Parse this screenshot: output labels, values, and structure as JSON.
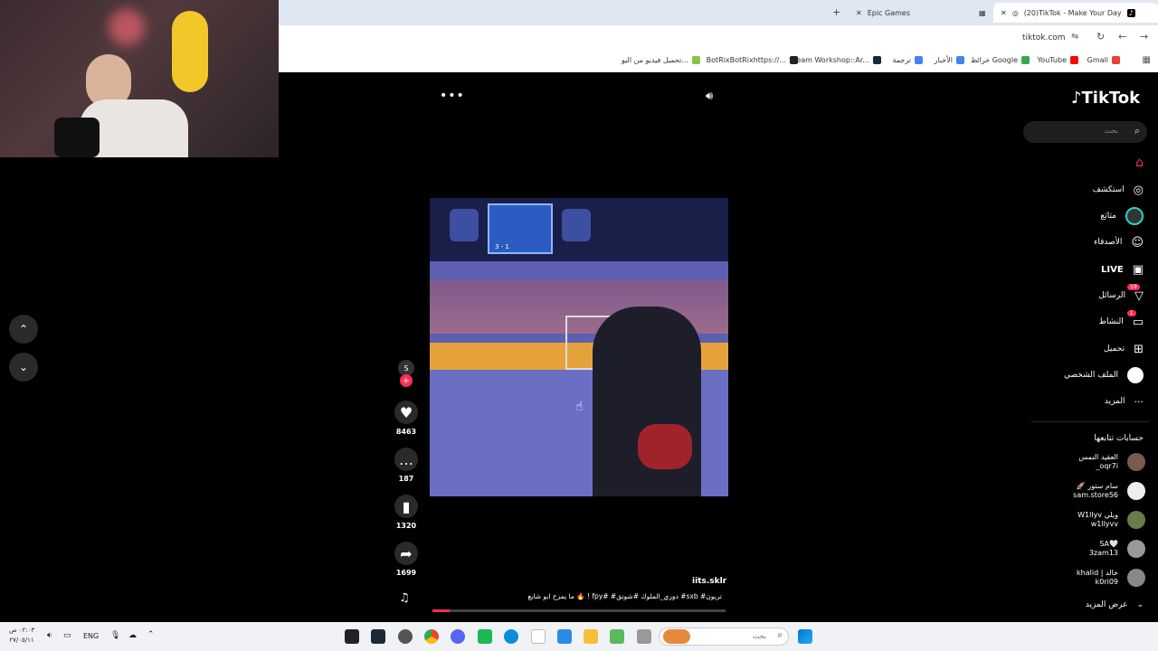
{
  "browser": {
    "tabs": [
      {
        "label": "(20)TikTok - Make Your Day",
        "active": true
      },
      {
        "label": "Epic Games",
        "active": false
      }
    ],
    "url": "tiktok.com",
    "bookmarks": [
      {
        "label": "Gmail",
        "color": "#ea4335"
      },
      {
        "label": "YouTube",
        "color": "#ff0000"
      },
      {
        "label": "خرائط Google",
        "color": "#34a853"
      },
      {
        "label": "الأخبار",
        "color": "#4285f4"
      },
      {
        "label": "ترجمة",
        "color": "#4285f4"
      },
      {
        "label": "Steam Workshop::Ar...",
        "color": "#1b2838"
      },
      {
        "label": "BotRixBotRixhttps://...",
        "color": "#222222"
      },
      {
        "label": "تحميل فيديو من اليو...",
        "color": "#8bc34a"
      }
    ]
  },
  "tiktok": {
    "logo": "TikTok",
    "search_placeholder": "بحث",
    "nav": [
      {
        "label": "",
        "icon": "home-icon",
        "color": "#fe2c55"
      },
      {
        "label": "استكشف",
        "icon": "compass-icon"
      },
      {
        "label": "متابَع",
        "icon": "following-icon"
      },
      {
        "label": "الأصدقاء",
        "icon": "friends-icon"
      },
      {
        "label": "LIVE",
        "icon": "live-icon"
      },
      {
        "label": "الرسائل",
        "icon": "messages-icon",
        "badge": "19"
      },
      {
        "label": "النشاط",
        "icon": "activity-icon",
        "badge": "1"
      },
      {
        "label": "تحميل",
        "icon": "upload-icon"
      },
      {
        "label": "الملف الشخصي",
        "icon": "profile-icon"
      },
      {
        "label": "المزيد",
        "icon": "more-icon"
      }
    ],
    "following_title": "حسابات تتابعها",
    "following": [
      {
        "name": "العقيد النمس",
        "handle": "_oqr7i"
      },
      {
        "name": "🚀 سام ستور",
        "handle": "sam.store56"
      },
      {
        "name": "W1llyv ويلي",
        "handle": "w1llyvv"
      },
      {
        "name": "SA🤍",
        "handle": "3zam13"
      },
      {
        "name": "khalid | خالد",
        "handle": "k0ri09"
      }
    ],
    "see_more": "عرض المزيد",
    "video": {
      "author": "iits.sklr",
      "caption": "ما يمزح ابو شايع 🔥 ! fpy# #دوري_الملوك #شوتق #sxb #تريون",
      "likes": "8463",
      "comments": "187",
      "saves": "1320",
      "shares": "1699",
      "scoreboard": "3 - 1"
    }
  },
  "taskbar": {
    "time": "٠٢:٠٣ ص",
    "date": "٢٧/٠٥/١١",
    "lang": "ENG",
    "search_placeholder": "بحث"
  }
}
